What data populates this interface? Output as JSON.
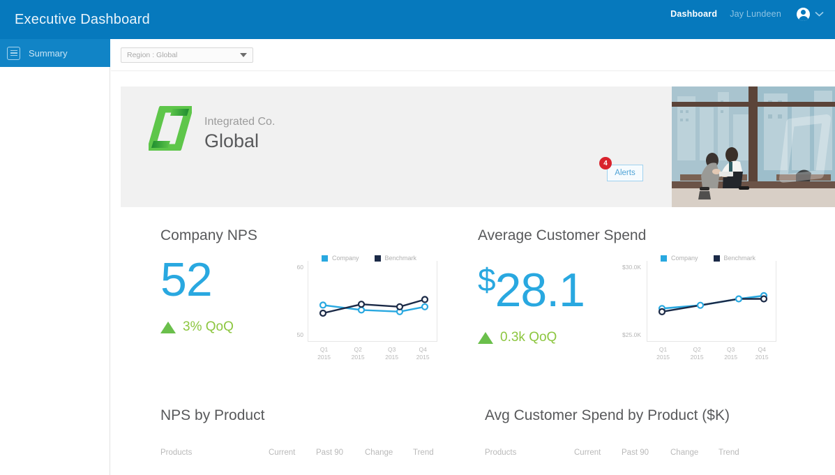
{
  "header": {
    "app_title": "Executive Dashboard",
    "nav_dashboard": "Dashboard",
    "user_name": "Jay Lundeen",
    "avatar_icon": "user-avatar-icon",
    "chevron_icon": "chevron-down-icon",
    "bar_color": "#0679bd"
  },
  "sidebar": {
    "items": [
      {
        "label": "Summary",
        "icon": "document-list-icon",
        "active": true
      }
    ]
  },
  "filterbar": {
    "region": {
      "value": "Region : Global",
      "placeholder": "Region : Global",
      "caret_icon": "caret-down-icon"
    }
  },
  "hero": {
    "logo_icon": "integrated-co-logo",
    "company": "Integrated Co.",
    "region": "Global",
    "alerts": {
      "label": "Alerts",
      "count": "4",
      "badge_color": "#d9232d",
      "border_color": "#9fd2ef"
    },
    "photo_alt": "two business people talking by an office window with city view"
  },
  "kpis": [
    {
      "title": "Company NPS",
      "value": "52",
      "prefix": "",
      "delta": "3% QoQ",
      "delta_direction": "up",
      "delta_color": "#8cc63f",
      "value_color": "#29a8e0"
    },
    {
      "title": "Average Customer Spend",
      "value": "28.1",
      "prefix": "$",
      "delta": "0.3k QoQ",
      "delta_direction": "up",
      "delta_color": "#8cc63f",
      "value_color": "#29a8e0"
    }
  ],
  "chart_data": [
    {
      "type": "line",
      "title": "Company NPS",
      "xlabel": "",
      "ylabel": "",
      "categories": [
        "Q1 2015",
        "Q2 2015",
        "Q3 2015",
        "Q4 2015"
      ],
      "x_tick_lines": [
        [
          "Q1",
          "2015"
        ],
        [
          "Q2",
          "2015"
        ],
        [
          "Q3",
          "2015"
        ],
        [
          "Q4",
          "2015"
        ]
      ],
      "y_ticks": [
        "60",
        "50"
      ],
      "ylim": [
        50,
        60
      ],
      "grid": false,
      "legend_position": "top",
      "series": [
        {
          "name": "Company",
          "color": "#29a8e0",
          "values": [
            53.6,
            53.0,
            52.8,
            53.4
          ]
        },
        {
          "name": "Benchmark",
          "color": "#1b2a47",
          "values": [
            52.6,
            53.7,
            53.4,
            54.3
          ]
        }
      ]
    },
    {
      "type": "line",
      "title": "Average Customer Spend",
      "xlabel": "",
      "ylabel": "",
      "categories": [
        "Q1 2015",
        "Q2 2015",
        "Q3 2015",
        "Q4 2015"
      ],
      "x_tick_lines": [
        [
          "Q1",
          "2015"
        ],
        [
          "Q2",
          "2015"
        ],
        [
          "Q3",
          "2015"
        ],
        [
          "Q4",
          "2015"
        ]
      ],
      "y_ticks": [
        "$30.0K",
        "$25.0K"
      ],
      "ylim": [
        25.0,
        30.0
      ],
      "grid": false,
      "legend_position": "top",
      "series": [
        {
          "name": "Company",
          "color": "#29a8e0",
          "values": [
            27.3,
            27.5,
            27.9,
            28.1
          ]
        },
        {
          "name": "Benchmark",
          "color": "#1b2a47",
          "values": [
            27.1,
            27.5,
            27.9,
            27.9
          ]
        }
      ]
    }
  ],
  "tables": [
    {
      "title": "NPS by Product",
      "columns": [
        "Products",
        "Current",
        "Past 90",
        "Change",
        "Trend"
      ]
    },
    {
      "title": "Avg Customer Spend by Product ($K)",
      "columns": [
        "Products",
        "Current",
        "Past 90",
        "Change",
        "Trend"
      ]
    }
  ]
}
